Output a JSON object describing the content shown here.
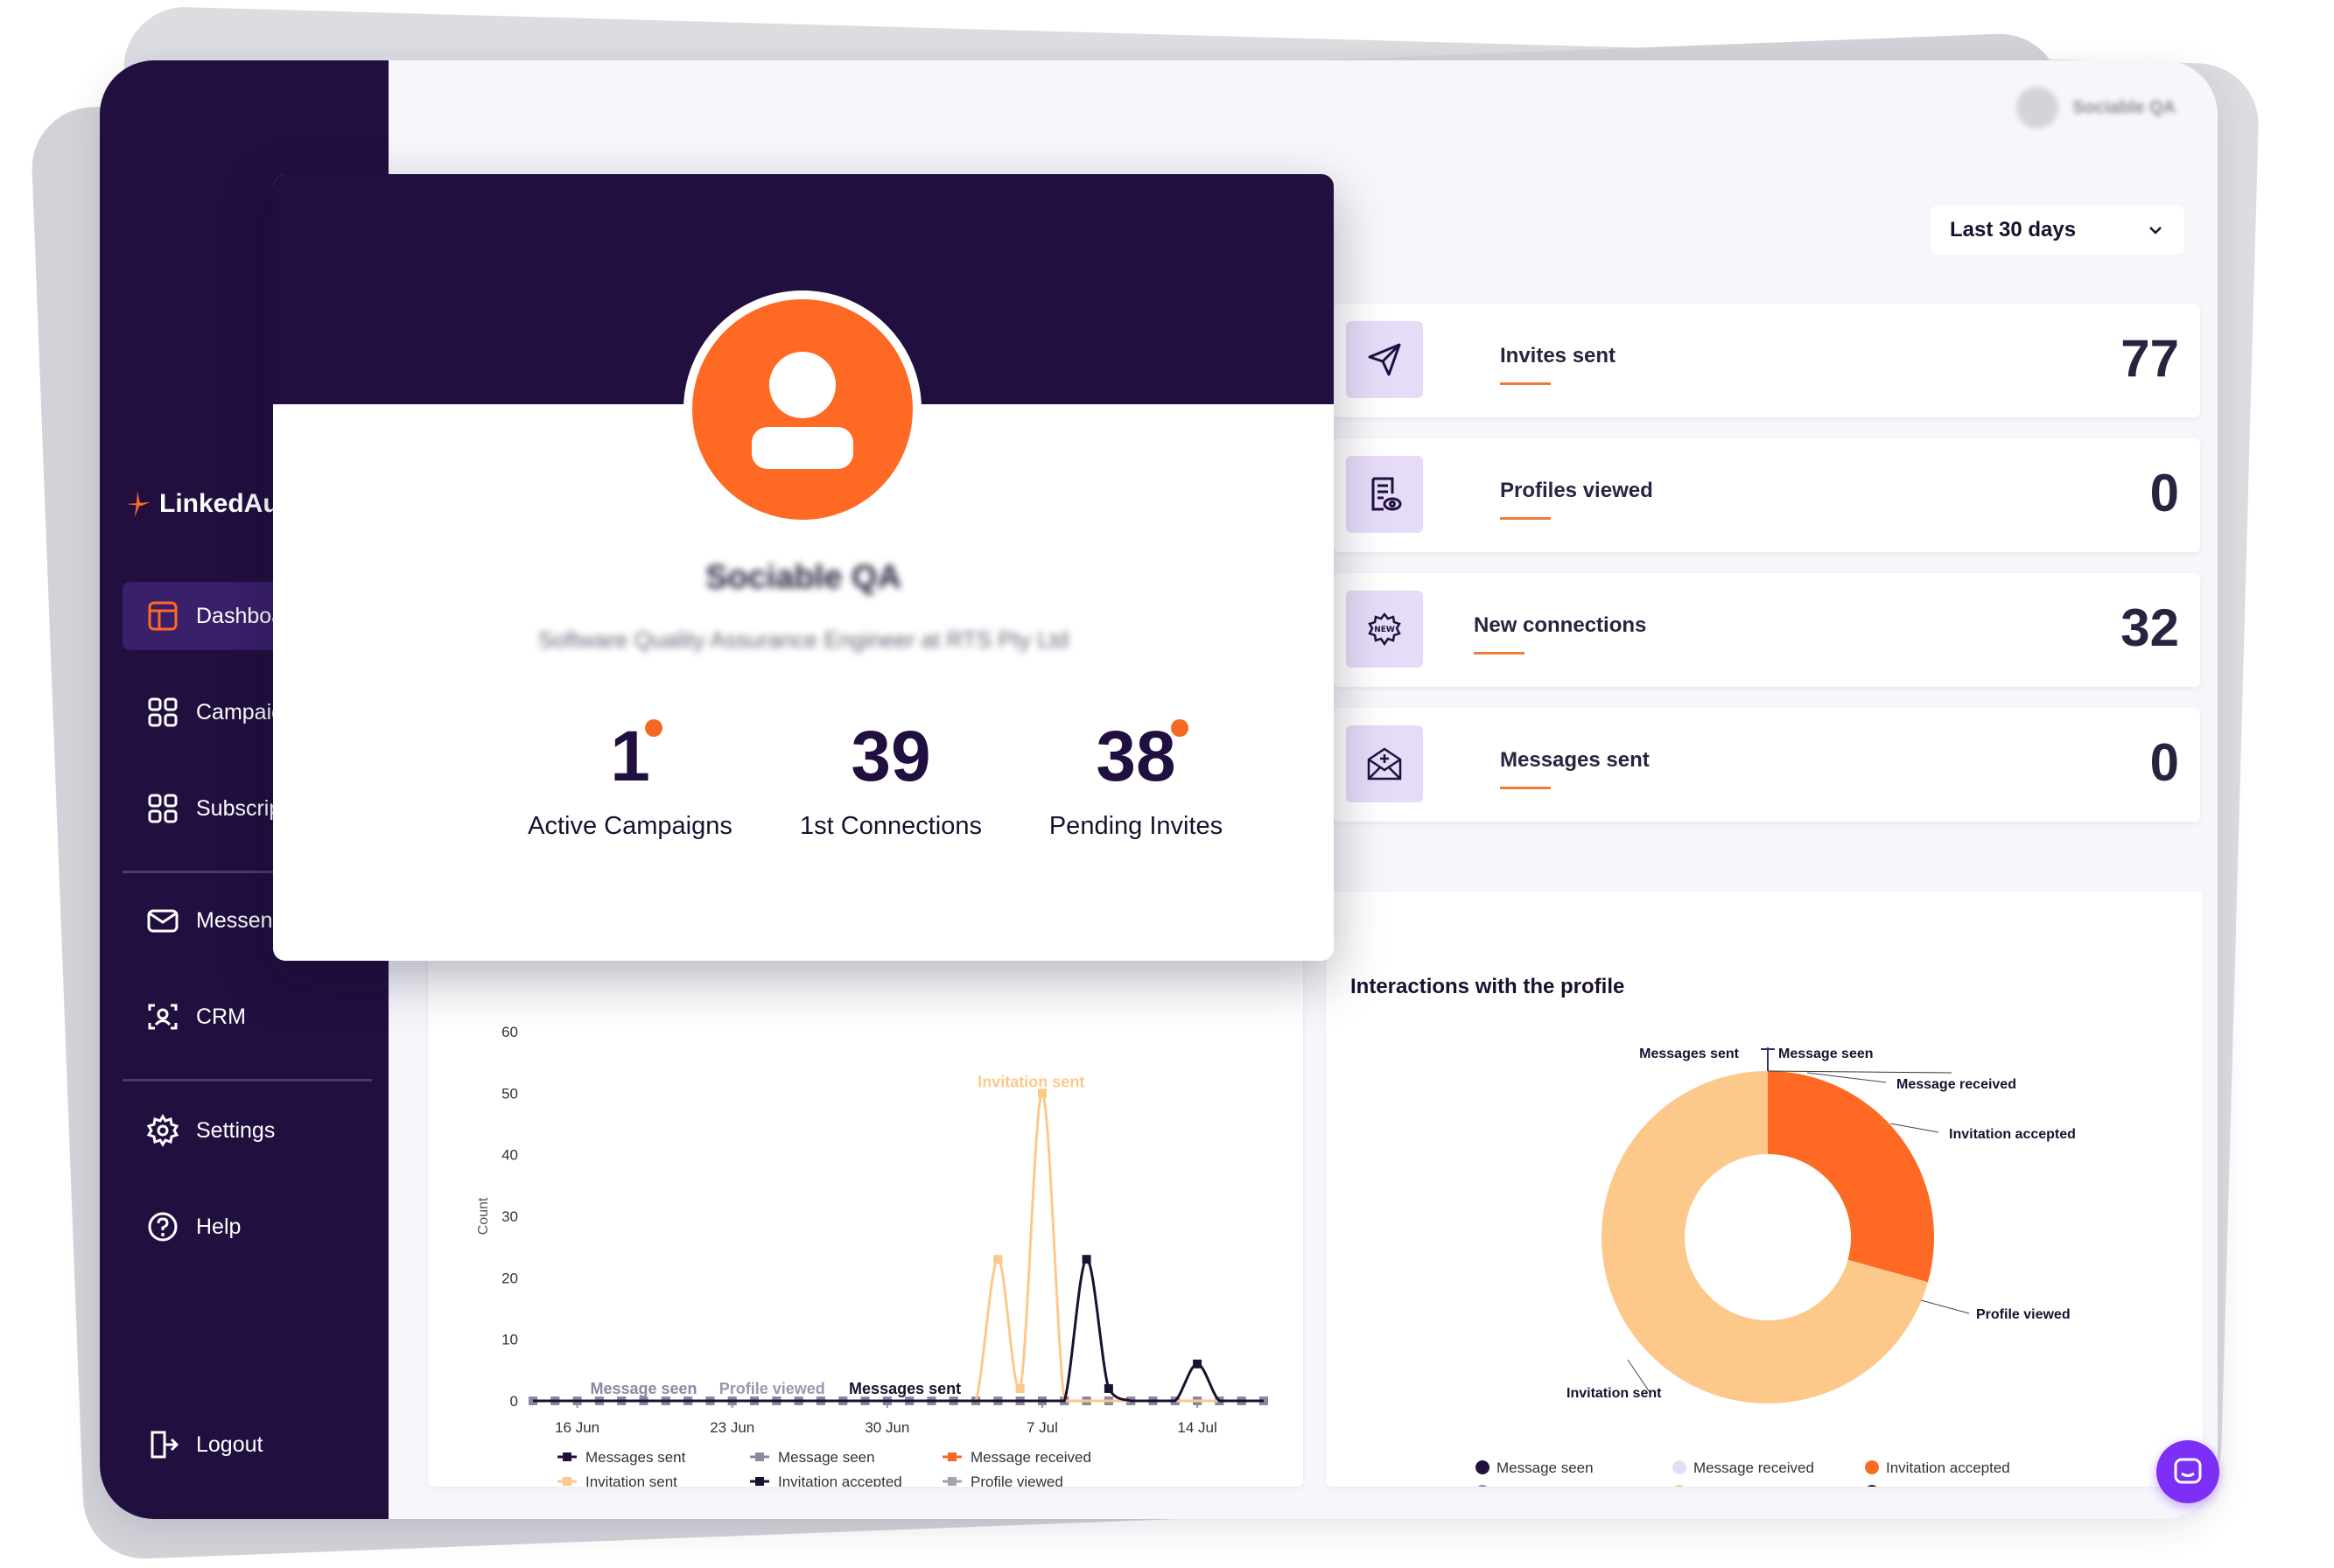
{
  "brand": {
    "name": "LinkedAu",
    "accent": "#fe6a24",
    "sidebar_bg": "#200f3f"
  },
  "sidebar": {
    "items": [
      {
        "label": "Dashboa",
        "icon": "layout-icon"
      },
      {
        "label": "Campaig",
        "icon": "grid-icon"
      },
      {
        "label": "Subscrip",
        "icon": "grid-icon"
      },
      {
        "label": "Messeng",
        "icon": "mail-icon"
      },
      {
        "label": "CRM",
        "icon": "contact-scan-icon"
      },
      {
        "label": "Settings",
        "icon": "gear-icon"
      },
      {
        "label": "Help",
        "icon": "help-icon"
      },
      {
        "label": "Logout",
        "icon": "logout-icon"
      }
    ]
  },
  "header": {
    "user_name": "Sociable QA",
    "range_label": "Last 30 days"
  },
  "stats": [
    {
      "label": "Invites sent",
      "value": "77",
      "icon": "send-icon"
    },
    {
      "label": "Profiles viewed",
      "value": "0",
      "icon": "profile-doc-icon"
    },
    {
      "label": "New connections",
      "value": "32",
      "icon": "new-badge-icon"
    },
    {
      "label": "Messages sent",
      "value": "0",
      "icon": "envelope-plus-icon"
    }
  ],
  "profile": {
    "name": "Sociable QA",
    "subtitle": "Software Quality Assurance Engineer at RTS Pty Ltd",
    "metrics": [
      {
        "value": "1",
        "label": "Active Campaigns",
        "dot": true
      },
      {
        "value": "39",
        "label": "1st Connections",
        "dot": false
      },
      {
        "value": "38",
        "label": "Pending Invites",
        "dot": true
      }
    ]
  },
  "line_chart": {
    "chart_data": {
      "type": "line",
      "ylabel": "Count",
      "ylim": [
        0,
        60
      ],
      "yticks": [
        "0",
        "10",
        "20",
        "30",
        "40",
        "50",
        "60"
      ],
      "xticks": [
        "16 Jun",
        "23 Jun",
        "30 Jun",
        "7 Jul",
        "14 Jul"
      ],
      "annotations": [
        "Invitation sent",
        "Message seen",
        "Profile viewed",
        "Messages sent"
      ],
      "x_days": [
        14,
        15,
        16,
        17,
        18,
        19,
        20,
        21,
        22,
        23,
        24,
        25,
        26,
        27,
        28,
        29,
        30,
        31,
        32,
        33,
        34,
        35,
        36,
        37,
        38,
        39,
        40,
        41,
        42,
        43,
        44,
        45,
        46,
        47
      ],
      "series": [
        {
          "name": "Messages sent",
          "color": "#200f3f",
          "values": [
            0,
            0,
            0,
            0,
            0,
            0,
            0,
            0,
            0,
            0,
            0,
            0,
            0,
            0,
            0,
            0,
            0,
            0,
            0,
            0,
            0,
            0,
            0,
            0,
            0,
            0,
            0,
            0,
            0,
            0,
            0,
            0,
            0,
            0
          ]
        },
        {
          "name": "Message seen",
          "color": "#8a88a0",
          "values": [
            0,
            0,
            0,
            0,
            0,
            0,
            0,
            0,
            0,
            0,
            0,
            0,
            0,
            0,
            0,
            0,
            0,
            0,
            0,
            0,
            0,
            0,
            0,
            0,
            0,
            0,
            0,
            0,
            0,
            0,
            0,
            0,
            0,
            0
          ]
        },
        {
          "name": "Message received",
          "color": "#f36a25",
          "values": [
            0,
            0,
            0,
            0,
            0,
            0,
            0,
            0,
            0,
            0,
            0,
            0,
            0,
            0,
            0,
            0,
            0,
            0,
            0,
            0,
            0,
            0,
            0,
            0,
            0,
            0,
            0,
            0,
            0,
            0,
            0,
            0,
            0,
            0
          ]
        },
        {
          "name": "Invitation sent",
          "color": "#fcc98a",
          "values": [
            0,
            0,
            0,
            0,
            0,
            0,
            0,
            0,
            0,
            0,
            0,
            0,
            0,
            0,
            0,
            0,
            0,
            0,
            0,
            0,
            0,
            23,
            2,
            50,
            0,
            0,
            0,
            0,
            0,
            0,
            0,
            0,
            0,
            0
          ]
        },
        {
          "name": "Invitation accepted",
          "color": "#1b1030",
          "values": [
            0,
            0,
            0,
            0,
            0,
            0,
            0,
            0,
            0,
            0,
            0,
            0,
            0,
            0,
            0,
            0,
            0,
            0,
            0,
            0,
            0,
            0,
            0,
            0,
            0,
            23,
            2,
            0,
            0,
            0,
            6,
            0,
            0,
            0
          ]
        },
        {
          "name": "Profile viewed",
          "color": "#a3a3ad",
          "values": [
            0,
            0,
            0,
            0,
            0,
            0,
            0,
            0,
            0,
            0,
            0,
            0,
            0,
            0,
            0,
            0,
            0,
            0,
            0,
            0,
            0,
            0,
            0,
            0,
            0,
            0,
            0,
            0,
            0,
            0,
            0,
            0,
            0,
            0
          ]
        }
      ]
    }
  },
  "donut_chart": {
    "title": "Interactions with the profile",
    "chart_data": {
      "type": "pie",
      "labels": [
        "Messages sent",
        "Message seen",
        "Message received",
        "Invitation accepted",
        "Profile viewed",
        "Invitation sent"
      ],
      "values": [
        0,
        0,
        0,
        32,
        0,
        77
      ],
      "colors": [
        "#200f3f",
        "#200f3f",
        "#e6dcf7",
        "#fe6a24",
        "#8a88a0",
        "#fcc98a"
      ]
    },
    "legend": [
      {
        "name": "Message seen",
        "color": "#200f3f"
      },
      {
        "name": "Message received",
        "color": "#e6dcf7"
      },
      {
        "name": "Invitation accepted",
        "color": "#fe6a24"
      },
      {
        "name": "Profile viewed",
        "color": "#8a88a0"
      },
      {
        "name": "Invitation sent",
        "color": "#fcc98a"
      },
      {
        "name": "Messages sent",
        "color": "#2a1754"
      }
    ]
  }
}
